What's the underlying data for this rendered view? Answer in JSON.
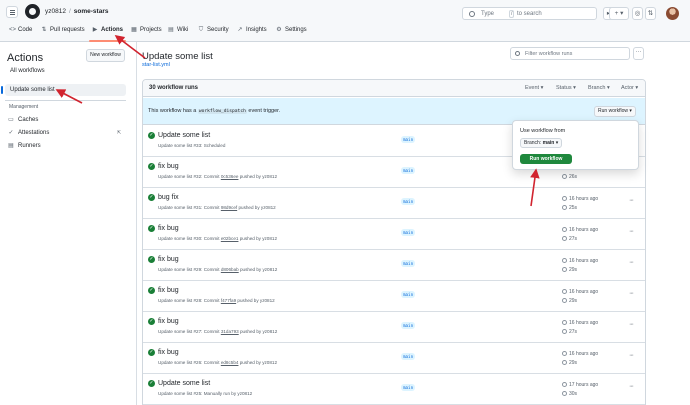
{
  "header": {
    "owner": "yz0812",
    "repo": "some-stars",
    "search_placeholder": "Type",
    "search_key": "/",
    "search_suffix": "to search",
    "plus_label": "+",
    "issues_glyph": "◎",
    "pr_glyph": "⇅",
    "inbox_glyph": "☐"
  },
  "tabs": [
    {
      "label": "Code",
      "icon": "code-icon",
      "glyph": "<>"
    },
    {
      "label": "Pull requests",
      "icon": "pull-request-icon",
      "glyph": "⇅"
    },
    {
      "label": "Actions",
      "icon": "play-icon",
      "glyph": "▶"
    },
    {
      "label": "Projects",
      "icon": "table-icon",
      "glyph": "▦"
    },
    {
      "label": "Wiki",
      "icon": "book-icon",
      "glyph": "▤"
    },
    {
      "label": "Security",
      "icon": "shield-icon",
      "glyph": "⛉"
    },
    {
      "label": "Insights",
      "icon": "graph-icon",
      "glyph": "↗"
    },
    {
      "label": "Settings",
      "icon": "gear-icon",
      "glyph": "⚙"
    }
  ],
  "sidebar": {
    "title": "Actions",
    "new_workflow": "New workflow",
    "all_workflows": "All workflows",
    "selected_workflow": "Update some list",
    "management_heading": "Management",
    "management": [
      {
        "label": "Caches",
        "icon": "database-icon",
        "glyph": "▭"
      },
      {
        "label": "Attestations",
        "icon": "verified-icon",
        "glyph": "✓"
      },
      {
        "label": "Runners",
        "icon": "server-icon",
        "glyph": "▤"
      }
    ],
    "external_glyph": "⇱"
  },
  "main": {
    "title": "Update some list",
    "file": "star-list.yml",
    "filter_placeholder": "Filter workflow runs",
    "kebab": "···",
    "runs_count": "30 workflow runs",
    "filters": [
      "Event",
      "Status",
      "Branch",
      "Actor"
    ],
    "dispatch_before": "This workflow has a",
    "dispatch_code": "workflow_dispatch",
    "dispatch_after": "event trigger.",
    "run_workflow_btn": "Run workflow ▾"
  },
  "popover": {
    "label": "Use workflow from",
    "branch_prefix": "Branch:",
    "branch": "main",
    "run_button": "Run workflow"
  },
  "runs": [
    {
      "title": "Update some list",
      "meta_pre": "Update some list #33: Scheduled",
      "commit": "",
      "meta_post": "",
      "branch": "main",
      "when": "",
      "duration": ""
    },
    {
      "title": "fix bug",
      "meta_pre": "Update some list #32: Commit",
      "commit": "0c536ee",
      "meta_post": "pushed by yz0812",
      "branch": "main",
      "when": "",
      "duration": "26s"
    },
    {
      "title": "bug fix",
      "meta_pre": "Update some list #31: Commit",
      "commit": "98d9cef",
      "meta_post": "pushed by yz0812",
      "branch": "main",
      "when": "16 hours ago",
      "duration": "25s"
    },
    {
      "title": "fix bug",
      "meta_pre": "Update some list #30: Commit",
      "commit": "e02bce1",
      "meta_post": "pushed by yz0812",
      "branch": "main",
      "when": "16 hours ago",
      "duration": "27s"
    },
    {
      "title": "fix bug",
      "meta_pre": "Update some list #29: Commit",
      "commit": "d806bab",
      "meta_post": "pushed by yz0812",
      "branch": "main",
      "when": "16 hours ago",
      "duration": "29s"
    },
    {
      "title": "fix bug",
      "meta_pre": "Update some list #28: Commit",
      "commit": "f477fa9",
      "meta_post": "pushed by yz0812",
      "branch": "main",
      "when": "16 hours ago",
      "duration": "29s"
    },
    {
      "title": "fix bug",
      "meta_pre": "Update some list #27: Commit",
      "commit": "31da793",
      "meta_post": "pushed by yz0812",
      "branch": "main",
      "when": "16 hours ago",
      "duration": "27s"
    },
    {
      "title": "fix bug",
      "meta_pre": "Update some list #26: Commit",
      "commit": "ed8c5b4",
      "meta_post": "pushed by yz0812",
      "branch": "main",
      "when": "16 hours ago",
      "duration": "29s"
    },
    {
      "title": "Update some list",
      "meta_pre": "Update some list #25: Manually run by yz0812",
      "commit": "",
      "meta_post": "",
      "branch": "main",
      "when": "17 hours ago",
      "duration": "30s"
    }
  ],
  "run_glyphs": {
    "check": "✓",
    "dots": "···",
    "caret": "▾"
  },
  "colors": {
    "accent": "#0969da",
    "success": "#1f883d",
    "annotation": "#d1242f",
    "tab_underline": "#fd8c73"
  }
}
